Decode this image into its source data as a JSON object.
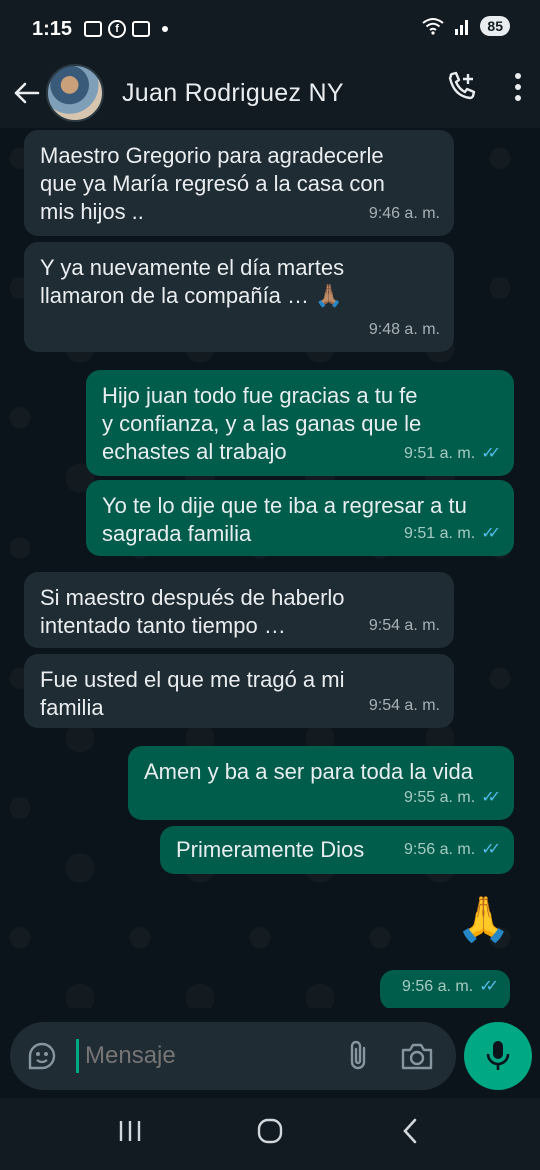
{
  "status_bar": {
    "time": "1:15",
    "battery": "85"
  },
  "header": {
    "contact_name": "Juan Rodriguez NY"
  },
  "messages": [
    {
      "dir": "in",
      "text": "Maestro Gregorio para agradecerle\nque ya María regresó a la casa con\nmis hijos ..",
      "time": "9:46 a. m."
    },
    {
      "dir": "in",
      "text": "Y ya nuevamente el día martes\nllamaron de la compañía … 🙏🏽",
      "time": "9:48 a. m."
    },
    {
      "dir": "out",
      "text": "Hijo juan todo fue gracias a tu fe\ny confianza, y a las ganas que le\nechastes al trabajo",
      "time": "9:51 a. m."
    },
    {
      "dir": "out",
      "text": "Yo te lo dije que te iba a regresar a tu\nsagrada familia",
      "time": "9:51 a. m."
    },
    {
      "dir": "in",
      "text": "Si maestro después de haberlo\nintentado tanto tiempo …",
      "time": "9:54 a. m."
    },
    {
      "dir": "in",
      "text": "Fue usted el que me tragó a mi\nfamilia",
      "time": "9:54 a. m."
    },
    {
      "dir": "out",
      "text": "Amen y ba a ser para toda la vida",
      "time": "9:55 a. m."
    },
    {
      "dir": "out",
      "text": "Primeramente Dios",
      "time": "9:56 a. m."
    },
    {
      "dir": "out",
      "text": "🙏",
      "time": "9:56 a. m."
    }
  ],
  "composer": {
    "placeholder": "Mensaje"
  },
  "icons": {
    "back": "arrow-left-icon",
    "add_call": "phone-plus-icon",
    "menu": "more-vert-icon",
    "sticker": "sticker-icon",
    "attach": "paperclip-icon",
    "camera": "camera-icon",
    "mic": "microphone-icon"
  },
  "colors": {
    "incoming": "#202c33",
    "outgoing": "#005c4b",
    "accent": "#00a884",
    "read_ticks": "#53bdeb"
  }
}
